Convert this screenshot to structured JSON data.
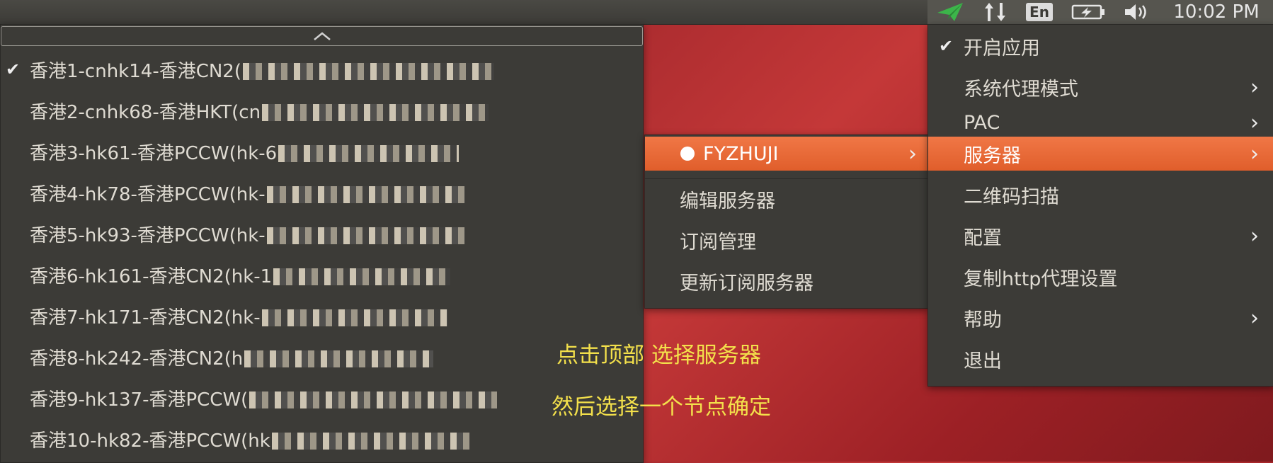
{
  "topbar": {
    "clock": "10:02 PM",
    "input_method": "En",
    "tray_icons": [
      "shadowsocks-plane-icon",
      "network-transfer-icon",
      "keyboard-en-icon",
      "battery-charging-icon",
      "volume-icon"
    ]
  },
  "server_list": {
    "scroll_indicator": "^",
    "items": [
      {
        "label": "香港1-cnhk14-香港CN2(",
        "checked": true
      },
      {
        "label": "香港2-cnhk68-香港HKT(cn",
        "checked": false
      },
      {
        "label": "香港3-hk61-香港PCCW(hk-6",
        "checked": false
      },
      {
        "label": "香港4-hk78-香港PCCW(hk-",
        "checked": false
      },
      {
        "label": "香港5-hk93-香港PCCW(hk-",
        "checked": false
      },
      {
        "label": "香港6-hk161-香港CN2(hk-1",
        "checked": false
      },
      {
        "label": "香港7-hk171-香港CN2(hk-",
        "checked": false
      },
      {
        "label": "香港8-hk242-香港CN2(h",
        "checked": false
      },
      {
        "label": "香港9-hk137-香港PCCW(",
        "checked": false
      },
      {
        "label": "香港10-hk82-香港PCCW(hk",
        "checked": false
      }
    ]
  },
  "subscription_menu": {
    "group": "FYZHUJI",
    "edit_servers": "编辑服务器",
    "subscription_manage": "订阅管理",
    "update_subscription": "更新订阅服务器"
  },
  "main_menu": {
    "enable_app": "开启应用",
    "proxy_mode": "系统代理模式",
    "pac": "PAC",
    "servers": "服务器",
    "qr_scan": "二维码扫描",
    "config": "配置",
    "copy_http": "复制http代理设置",
    "help": "帮助",
    "quit": "退出"
  },
  "annotations": {
    "line1": "点击顶部 选择服务器",
    "line2": "然后选择一个节点确定"
  },
  "colors": {
    "accent": "#e9632f",
    "menu_bg": "#3c3b37",
    "annotation": "#f3e04b"
  }
}
